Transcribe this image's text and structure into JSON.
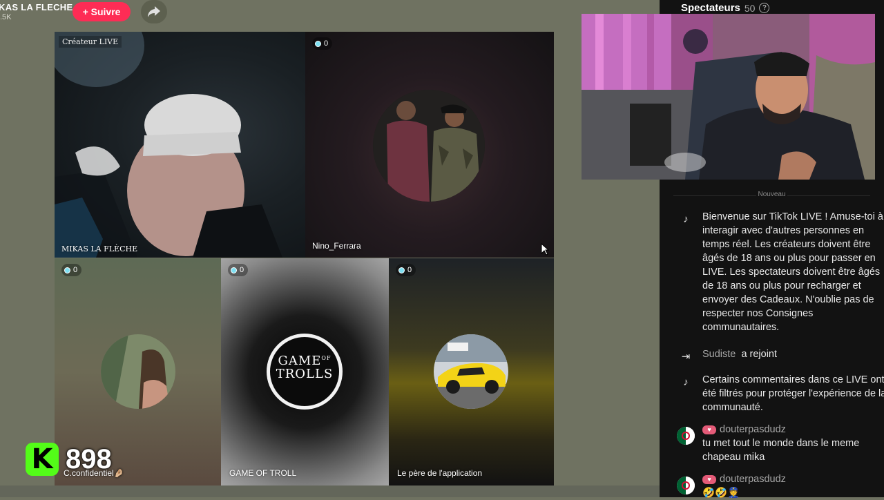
{
  "topbar": {
    "creator_name": "KAS LA FLECHE",
    "creator_count": ".5K",
    "follow_label": "+ Suivre",
    "share_icon": "share-arrow-icon"
  },
  "tiles": {
    "host": {
      "tag": "Créateur LIVE",
      "label": "MIKAS LA FLÈCHE"
    },
    "guest1": {
      "badge": "0",
      "label": "Nino_Ferrara"
    },
    "guest2": {
      "badge": "0",
      "label": "C.confidentiel🤌🏼"
    },
    "guest3": {
      "badge": "0",
      "label": "GAME OF TROLL",
      "logo_line1": "GAME",
      "logo_of": "OF",
      "logo_line2": "TROLLS"
    },
    "guest4": {
      "badge": "0",
      "label": "Le père de l'application"
    }
  },
  "score": {
    "logo": "K",
    "value": "898"
  },
  "panel": {
    "title": "Spectateurs",
    "count": "50",
    "divider": "Nouveau",
    "messages": [
      {
        "icon": "tiktok-icon",
        "text": "Bienvenue sur TikTok LIVE ! Amuse-toi à interagir avec d'autres personnes en temps réel. Les créateurs doivent être âgés de 18 ans ou plus pour passer en LIVE. Les spectateurs doivent être âgés de 18 ans ou plus pour recharger et envoyer des Cadeaux. N'oublie pas de respecter nos Consignes communautaires."
      },
      {
        "icon": "join-icon",
        "user": "Sudiste",
        "text": "a rejoint"
      },
      {
        "icon": "tiktok-icon",
        "text": "Certains commentaires dans ce LIVE ont été filtrés pour protéger l'expérience de la communauté."
      },
      {
        "icon": "flag-algeria",
        "user": "douterpasdudz",
        "text": "tu met tout le monde dans le meme chapeau mika"
      },
      {
        "icon": "flag-algeria",
        "user": "douterpasdudz",
        "text": "🤣🤣👮"
      }
    ]
  },
  "colors": {
    "follow": "#fe2c55",
    "kick": "#53fc18",
    "panel_bg": "#121212"
  }
}
